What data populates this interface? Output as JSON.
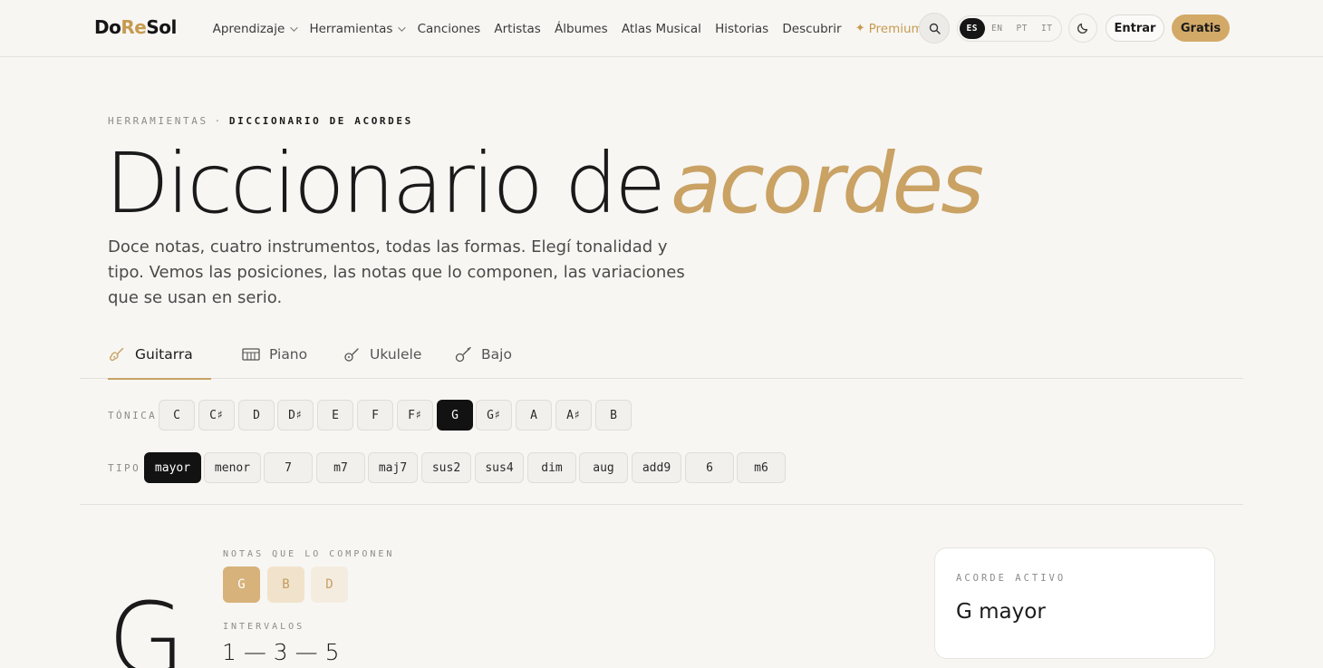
{
  "header": {
    "logo": {
      "part1": "Do",
      "part2": "Re",
      "part3": "Sol"
    },
    "nav": [
      {
        "label": "Aprendizaje",
        "dropdown": true
      },
      {
        "label": "Herramientas",
        "dropdown": true
      },
      {
        "label": "Canciones"
      },
      {
        "label": "Artistas"
      },
      {
        "label": "Álbumes"
      },
      {
        "label": "Atlas Musical"
      },
      {
        "label": "Historias"
      },
      {
        "label": "Descubrir"
      }
    ],
    "premium": {
      "icon": "✦",
      "label": "Premium"
    },
    "languages": [
      "ES",
      "EN",
      "PT",
      "IT"
    ],
    "active_language": "ES",
    "login_label": "Entrar",
    "signup_label": "Gratis"
  },
  "breadcrumb": {
    "parent": "HERRAMIENTAS",
    "separator": "·",
    "current": "DICCIONARIO DE ACORDES"
  },
  "hero": {
    "title_plain": "Diccionario de",
    "title_accent": "acordes",
    "intro": "Doce notas, cuatro instrumentos, todas las formas. Elegí tonalidad y tipo. Vemos las posiciones, las notas que lo componen, las variaciones que se usan en serio."
  },
  "instruments": {
    "active": "Guitarra",
    "items": [
      {
        "label": "Guitarra",
        "icon": "guitar-icon"
      },
      {
        "label": "Piano",
        "icon": "piano-icon"
      },
      {
        "label": "Ukulele",
        "icon": "ukulele-icon"
      },
      {
        "label": "Bajo",
        "icon": "bass-icon"
      }
    ]
  },
  "tonic": {
    "label": "TÓNICA",
    "options": [
      "C",
      "C♯",
      "D",
      "D♯",
      "E",
      "F",
      "F♯",
      "G",
      "G♯",
      "A",
      "A♯",
      "B"
    ],
    "selected": "G"
  },
  "type": {
    "label": "TIPO",
    "options": [
      "mayor",
      "menor",
      "7",
      "m7",
      "maj7",
      "sus2",
      "sus4",
      "dim",
      "aug",
      "add9",
      "6",
      "m6"
    ],
    "selected": "mayor"
  },
  "chord": {
    "root": "G",
    "notes_label": "NOTAS QUE LO COMPONEN",
    "notes": [
      "G",
      "B",
      "D"
    ],
    "intervals_label": "INTERVALOS",
    "intervals": "1 — 3 — 5"
  },
  "active_chord": {
    "label": "ACORDE ACTIVO",
    "value": "G mayor"
  },
  "colors": {
    "accent": "#c9a264",
    "button_gold": "#d3a968",
    "dark": "#121212",
    "background": "#f7f6f3"
  }
}
